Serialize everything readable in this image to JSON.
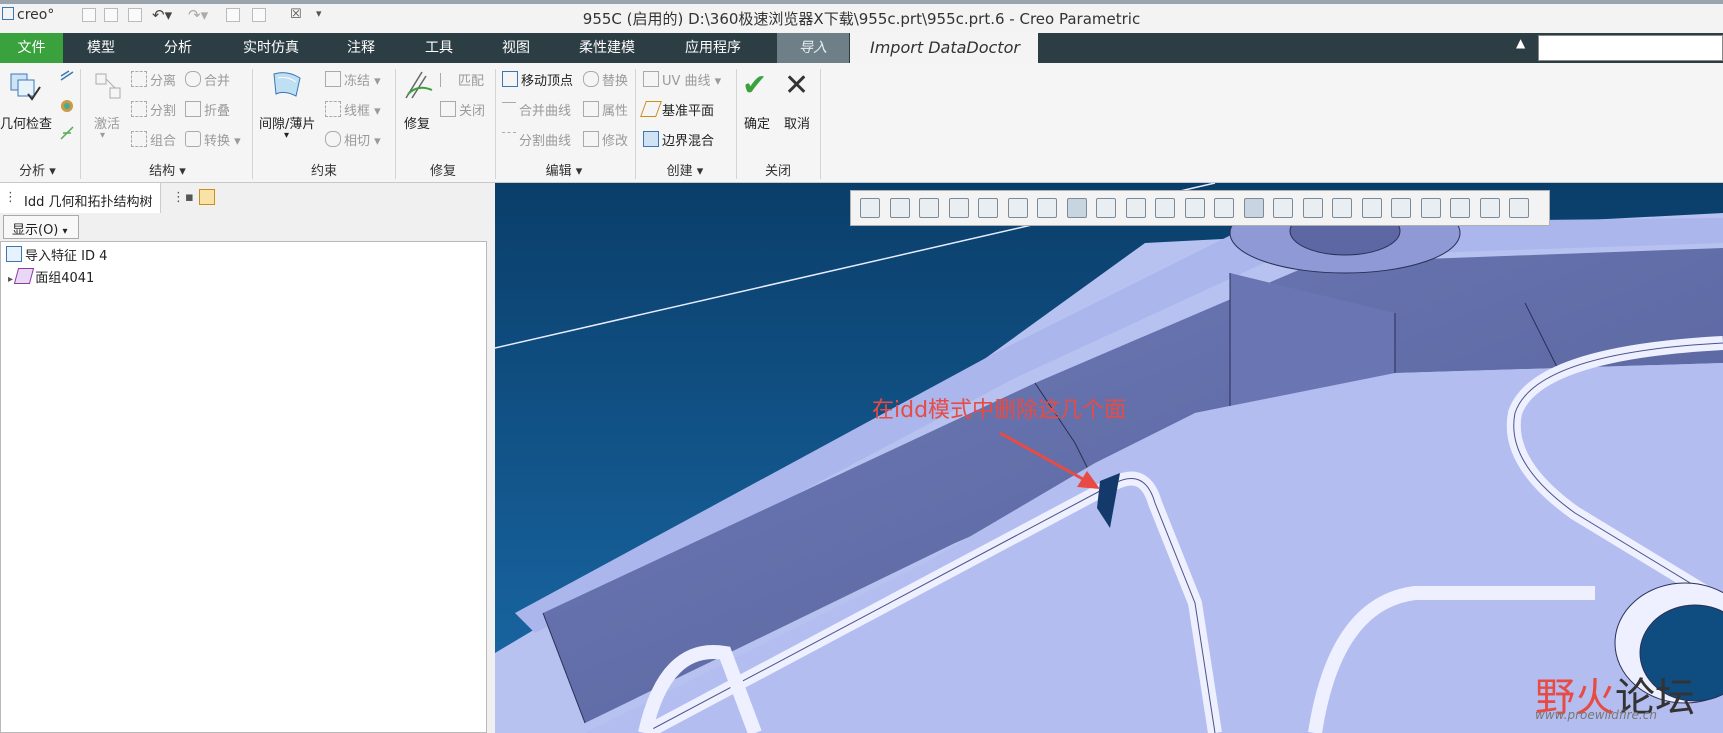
{
  "app": {
    "logo": "creo°",
    "window_title": "955C (启用的) D:\\360极速浏览器X下载\\955c.prt\\955c.prt.6 - Creo Parametric"
  },
  "menu": {
    "file": "文件",
    "tabs": [
      "模型",
      "分析",
      "实时仿真",
      "注释",
      "工具",
      "视图",
      "柔性建模",
      "应用程序"
    ],
    "import": "导入",
    "idd": "Import DataDoctor"
  },
  "ribbon": {
    "analysis": {
      "title": "分析",
      "geometry_check": "几何检查"
    },
    "structure": {
      "title": "结构",
      "activate": "激活",
      "separate": "分离",
      "merge": "合并",
      "split": "分割",
      "fold": "折叠",
      "group": "组合",
      "convert": "转换"
    },
    "constraint": {
      "title": "约束",
      "gap_sheet": "间隙/薄片",
      "freeze": "冻结",
      "wireframe": "线框",
      "tangent": "相切"
    },
    "repair": {
      "title": "修复",
      "repair": "修复",
      "match": "匹配",
      "close": "关闭"
    },
    "edit": {
      "title": "编辑",
      "move_vertex": "移动顶点",
      "replace": "替换",
      "merge_curves": "合并曲线",
      "properties": "属性",
      "split_curves": "分割曲线",
      "modify": "修改"
    },
    "create": {
      "title": "创建",
      "uv_curve": "UV 曲线",
      "datum_plane": "基准平面",
      "boundary_blend": "边界混合"
    },
    "close": {
      "title": "关闭",
      "ok": "确定",
      "cancel": "取消"
    }
  },
  "tree": {
    "title": "Idd 几何和拓扑结构树",
    "show_button": "显示(O)",
    "items": [
      {
        "label": "导入特征 ID 4"
      },
      {
        "label": "面组4041"
      }
    ]
  },
  "viewport": {
    "annotation": "在idd模式中删除这几个面",
    "watermark_cn_1": "野火",
    "watermark_cn_2": "论坛",
    "watermark_url": "www.proewildfire.cn"
  }
}
